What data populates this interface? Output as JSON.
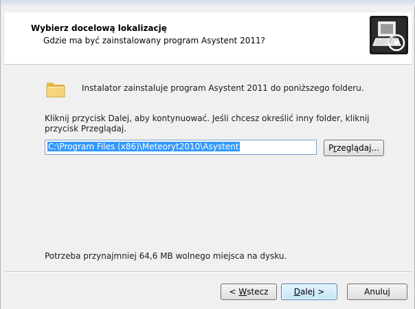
{
  "header": {
    "title": "Wybierz docelową lokalizację",
    "subtitle": "Gdzie ma być zainstalowany program Asystent 2011?",
    "icon": "computer-disk-icon"
  },
  "main": {
    "lead_text": "Instalator zainstaluje program Asystent 2011 do poniższego folderu.",
    "instruction": "Kliknij przycisk Dalej, aby kontynuować. Jeśli chcesz określić inny folder, kliknij przycisk Przeglądaj.",
    "path_value": "C:\\Program Files (x86)\\Meteoryt2010\\Asystent",
    "browse_label": {
      "pre": "P",
      "u": "r",
      "post": "zeglądaj..."
    },
    "space_text": "Potrzeba przynajmniej 64,6 MB wolnego miejsca na dysku."
  },
  "footer": {
    "back": {
      "pre": "< ",
      "u": "W",
      "post": "stecz"
    },
    "next": {
      "pre": "",
      "u": "D",
      "post": "alej >"
    },
    "cancel": "Anuluj"
  },
  "colors": {
    "selection": "#3399ff",
    "default_button_border": "#3c7fb1"
  }
}
